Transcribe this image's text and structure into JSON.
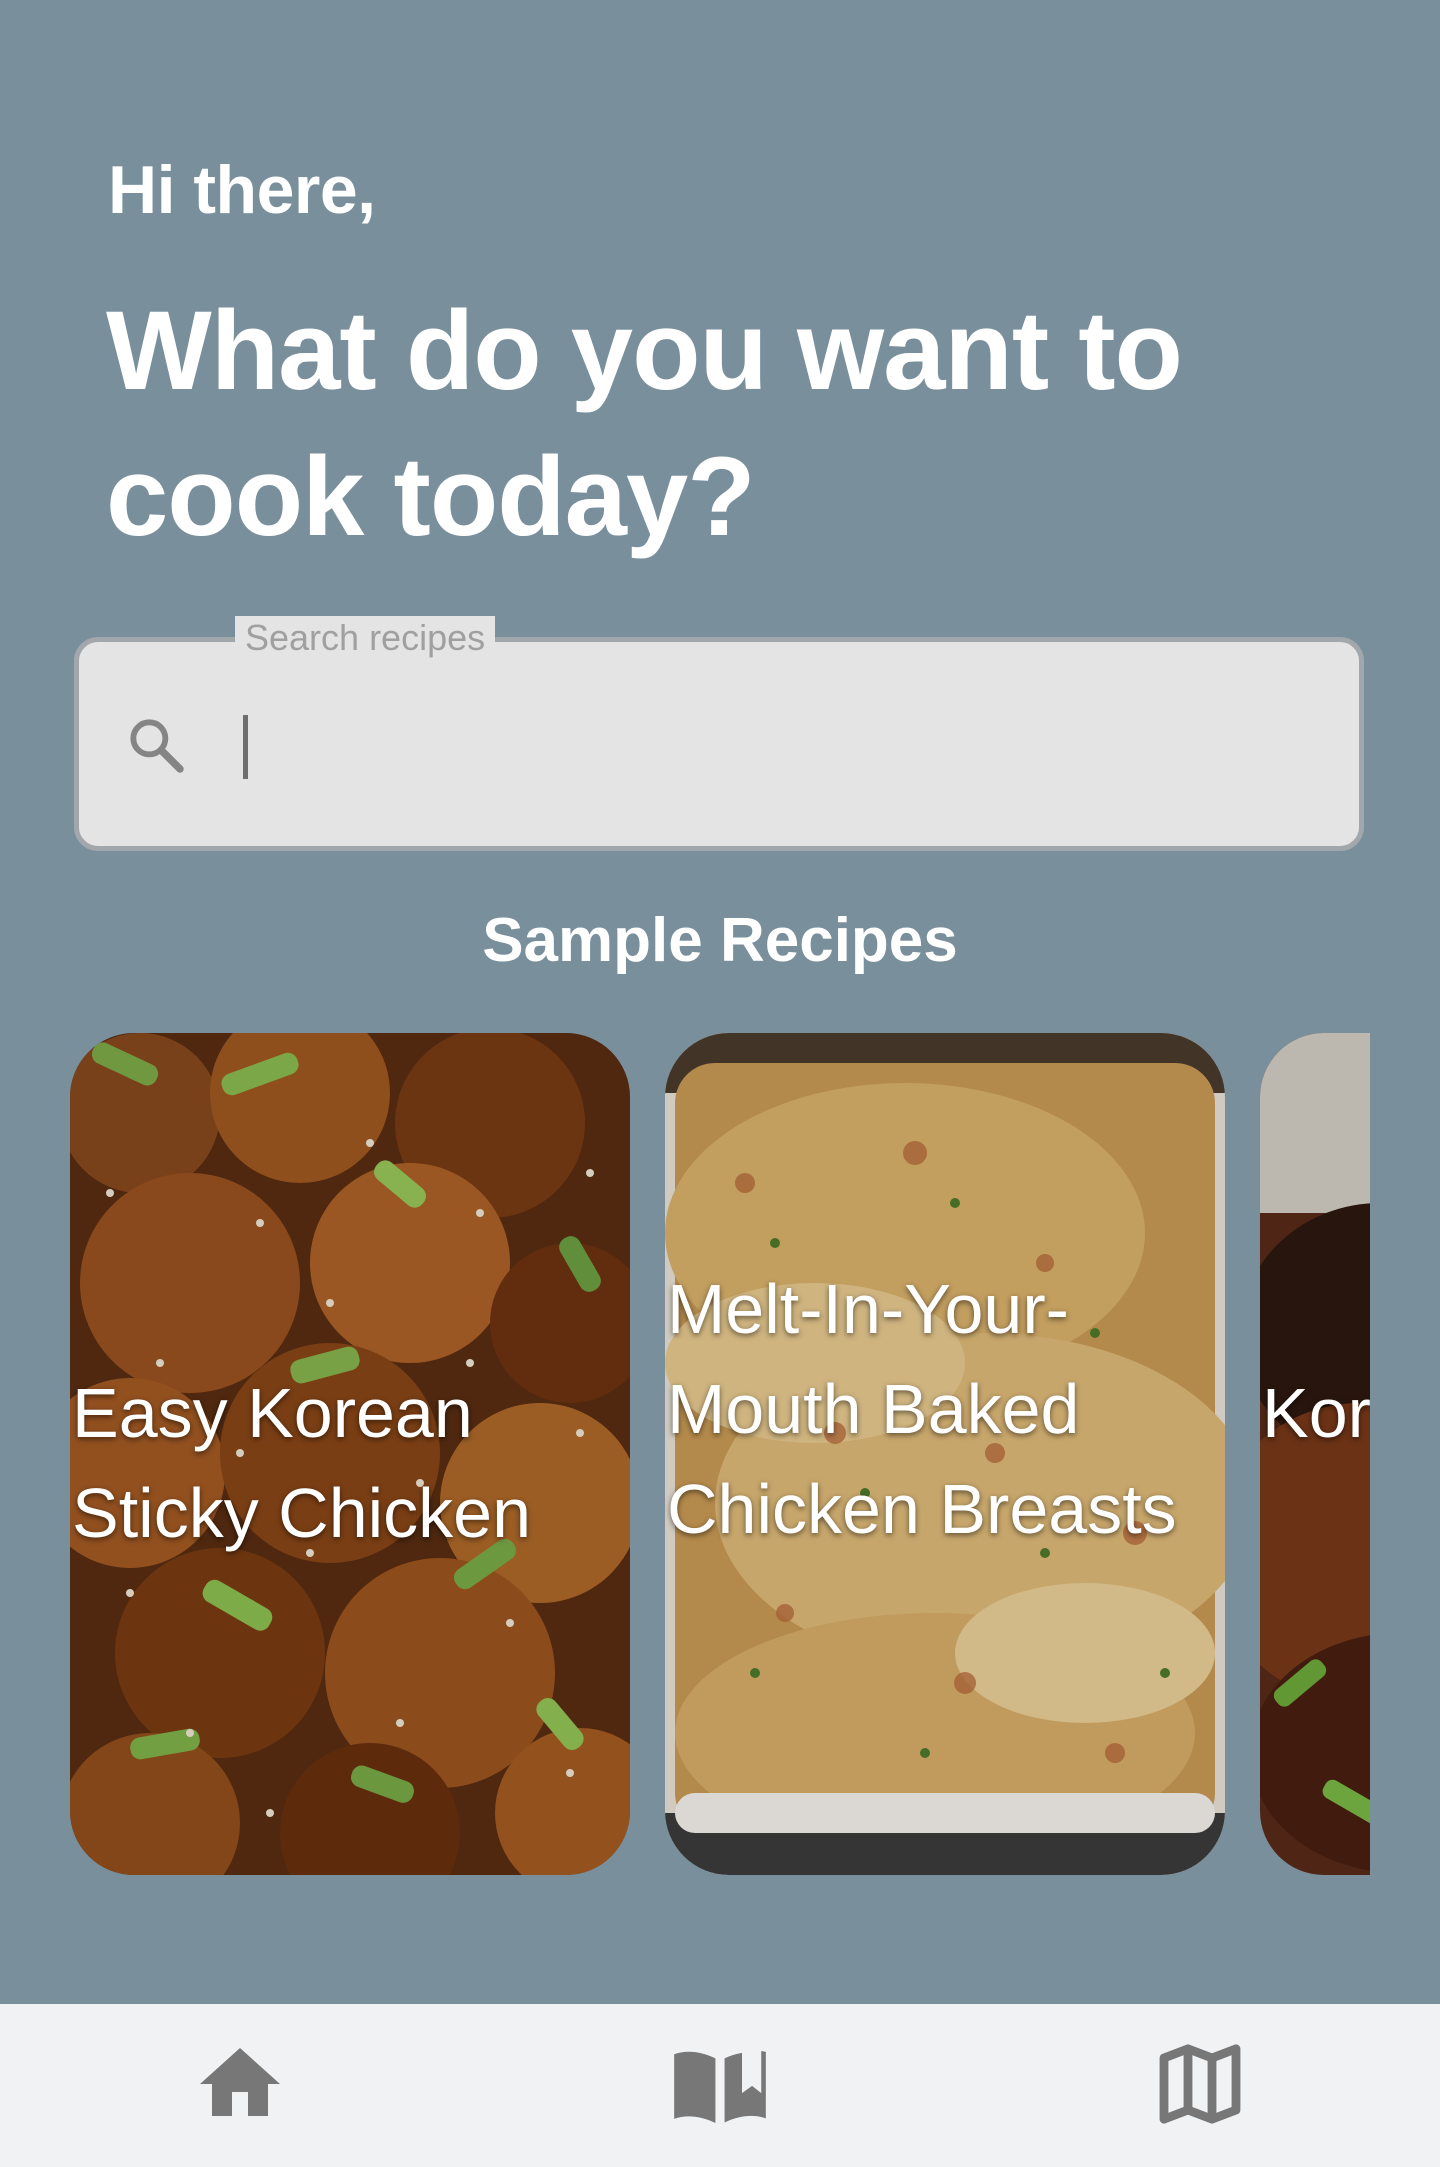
{
  "header": {
    "greeting": "Hi there,",
    "headline": "What do you want to cook today?"
  },
  "search": {
    "label": "Search recipes",
    "placeholder": "",
    "value": "",
    "icon": "search-icon"
  },
  "recipes": {
    "section_title": "Sample Recipes",
    "cards": [
      {
        "title": "Easy Korean Sticky Chicken"
      },
      {
        "title": "Melt-In-Your-Mouth Baked Chicken Breasts"
      },
      {
        "title": "Korean Chicken"
      }
    ]
  },
  "bottom_nav": {
    "items": [
      {
        "icon": "home-icon"
      },
      {
        "icon": "book-icon"
      },
      {
        "icon": "map-icon"
      }
    ]
  },
  "colors": {
    "background": "#798f9c",
    "search_fill": "#e4e4e4",
    "nav_background": "#f1f2f4",
    "nav_icon": "#777777"
  }
}
